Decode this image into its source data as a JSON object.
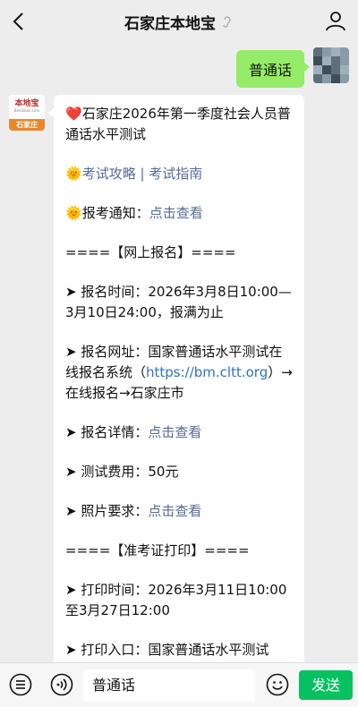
{
  "header": {
    "title": "石家庄本地宝"
  },
  "outgoing": {
    "text": "普通话"
  },
  "bot_avatar": {
    "top_text": "本地宝",
    "mid_text": "Bendibao.com",
    "bottom_text": "石家庄"
  },
  "message": {
    "heart": "❤️",
    "title": "石家庄2026年第一季度社会人员普通话水平测试",
    "sun": "🌞",
    "guide_link1": "考试攻略",
    "guide_sep": " | ",
    "guide_link2": "考试指南",
    "notice_label": "报考通知：",
    "notice_link": "点击查看",
    "section_online": "====【网上报名】====",
    "arrow": "➤",
    "reg_time": "报名时间：2026年3月8日10:00—3月10日24:00，报满为止",
    "reg_site_prefix": "报名网址：国家普通话水平测试在线报名系统（",
    "reg_site_url": "https://bm.cltt.org",
    "reg_site_suffix": "）→在线报名→石家庄市",
    "reg_detail_label": "报名详情：",
    "reg_detail_link": "点击查看",
    "fee": "测试费用：50元",
    "photo_label": "照片要求：",
    "photo_link": "点击查看",
    "section_print": "====【准考证打印】====",
    "print_time": "打印时间：2026年3月11日10:00至3月27日12:00",
    "print_entry": "打印入口：国家普通话水平测试"
  },
  "input": {
    "text": "普通话"
  },
  "send_label": "发送"
}
